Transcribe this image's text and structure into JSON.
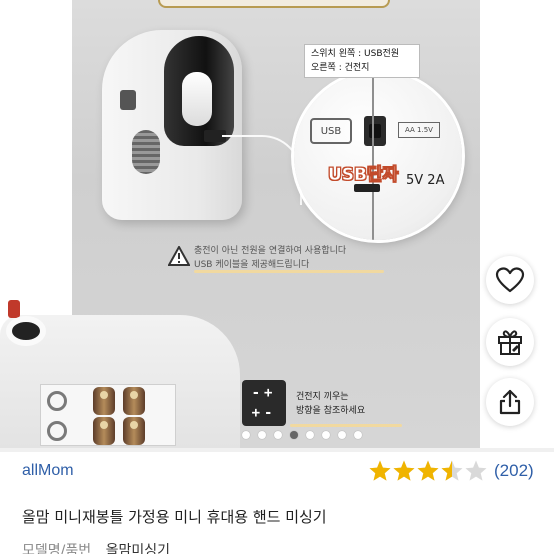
{
  "product_image": {
    "callout": {
      "line1": "스위치 왼쪽 : USB전원",
      "line2": "오른쪽 : 건전지"
    },
    "zoom": {
      "usb_icon_label": "USB",
      "battery_label": "AA 1.5V",
      "port_label": "USB단자",
      "voltage": "5V 2A"
    },
    "warning": {
      "line1": "충전이 아닌 전원을 연결하여 사용합니다",
      "line2": "USB 케이블을 제공해드립니다"
    },
    "polarity": {
      "row1": "-+",
      "row2": "+-"
    },
    "battery_note": {
      "line1": "건전지 끼우는",
      "line2": "방향을 참조하세요"
    },
    "carousel": {
      "total": 8,
      "active_index": 3
    }
  },
  "actions": {
    "like_icon": "heart-icon",
    "gift_icon": "gift-icon",
    "share_icon": "share-icon"
  },
  "product": {
    "brand": "allMom",
    "rating": 3.5,
    "review_count": "(202)",
    "title": "올맘 미니재봉틀 가정용 미니 휴대용 핸드 미싱기",
    "model_label": "모델명/품번",
    "model_value": "올맘미싱기"
  },
  "colors": {
    "accent_blue": "#2f5fa8",
    "star_gold": "#f0b400",
    "star_empty": "#d9d9d9"
  }
}
